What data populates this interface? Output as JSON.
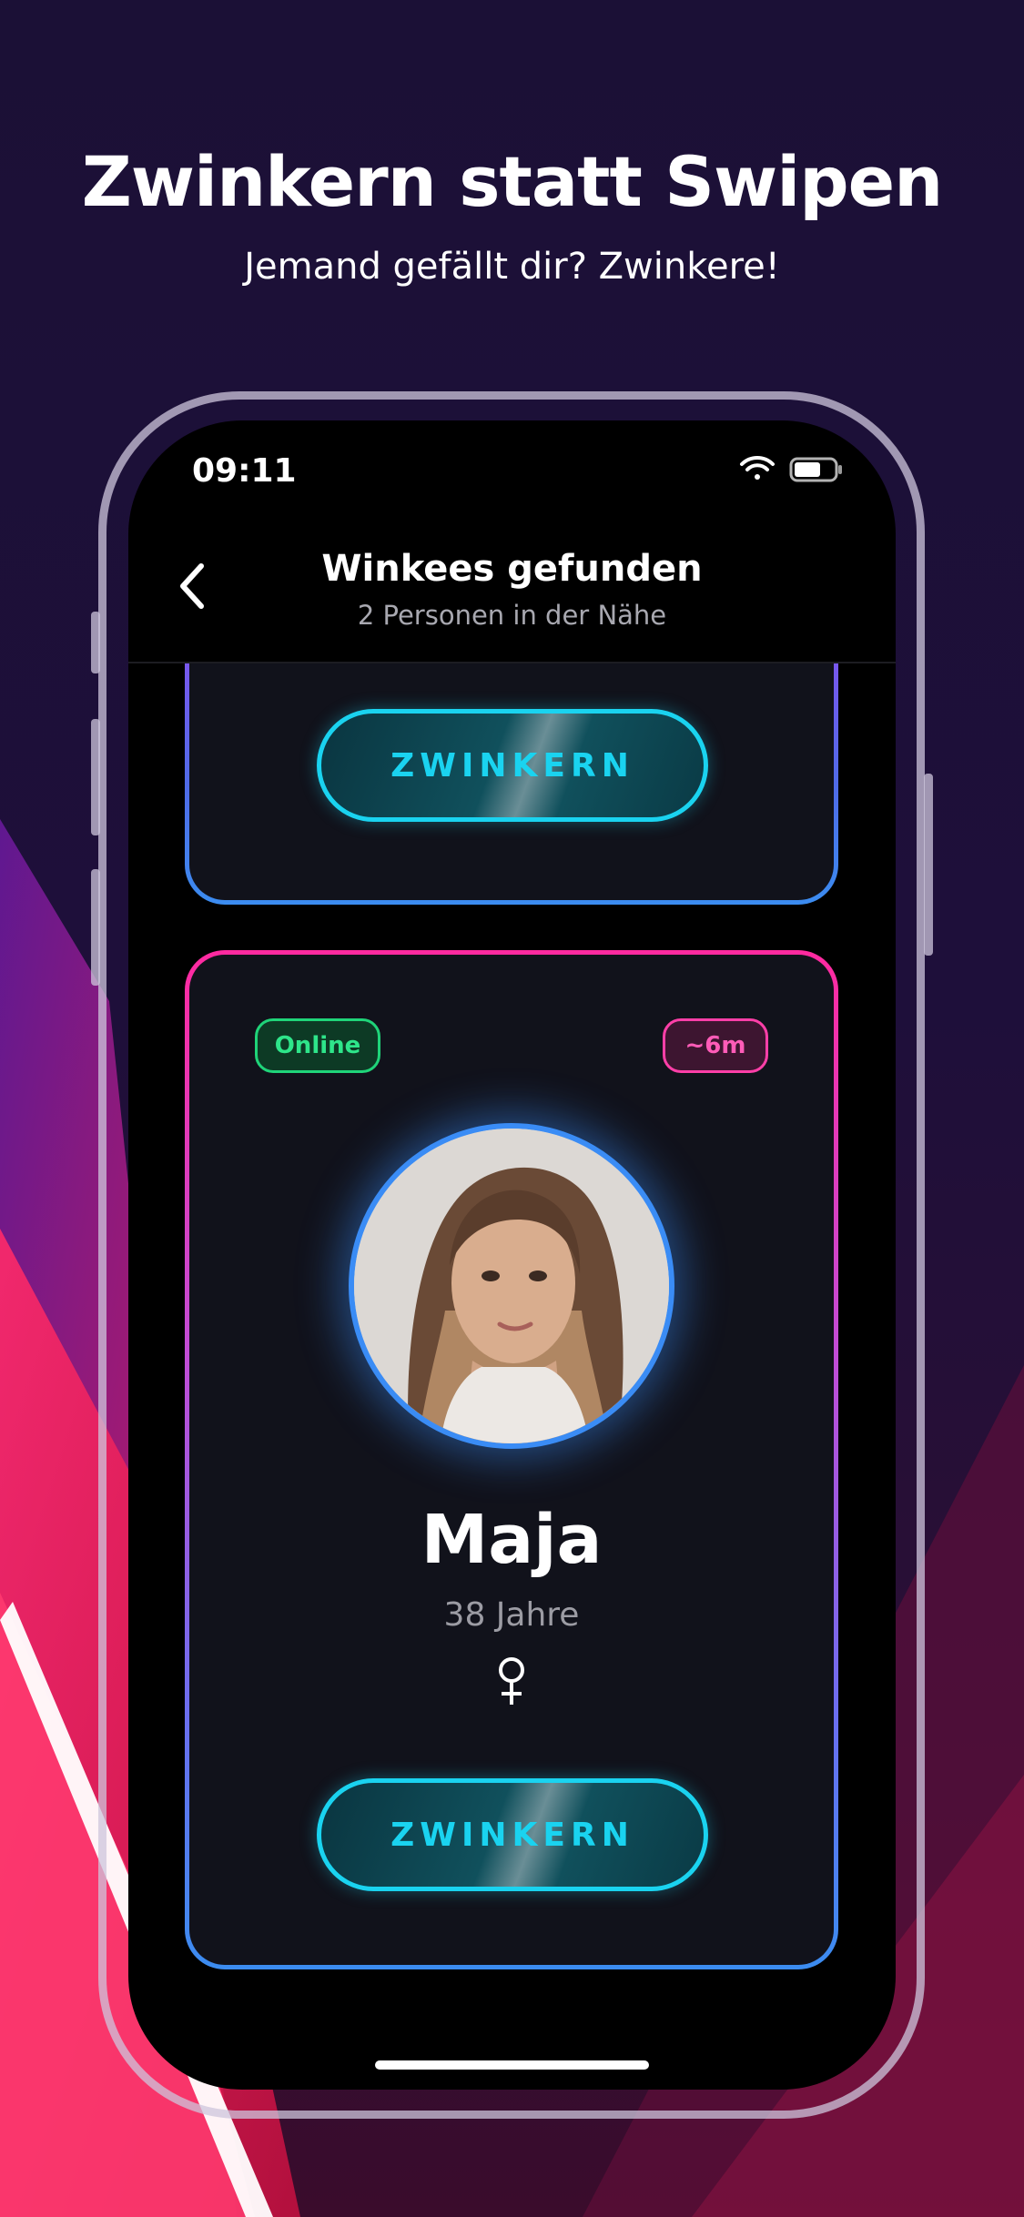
{
  "hero": {
    "headline": "Zwinkern statt Swipen",
    "subheadline": "Jemand gefällt dir? Zwinkere!"
  },
  "status_bar": {
    "time": "09:11",
    "icons": [
      "wifi-icon",
      "battery-icon"
    ]
  },
  "nav": {
    "back_icon": "chevron-left-icon",
    "title": "Winkees gefunden",
    "subtitle": "2 Personen in der Nähe"
  },
  "cards": [
    {
      "button_label": "ZWINKERN"
    },
    {
      "status_badge": "Online",
      "distance_badge": "~6m",
      "name": "Maja",
      "age": "38 Jahre",
      "gender_icon": "female-symbol-icon",
      "button_label": "ZWINKERN"
    }
  ],
  "colors": {
    "background": "#1a0f33",
    "accent_cyan": "#1ad3f0",
    "online_green": "#2ee58a",
    "distance_pink": "#ff5cb8",
    "avatar_ring": "#3a8cf5"
  }
}
